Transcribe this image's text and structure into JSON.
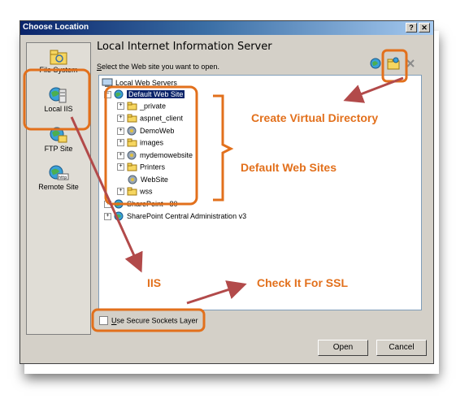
{
  "window": {
    "title": "Choose Location",
    "help_label": "?",
    "close_label": "✕"
  },
  "sidebar": {
    "items": [
      {
        "label": "File System",
        "icon": "folder-icon"
      },
      {
        "label": "Local IIS",
        "icon": "server-icon"
      },
      {
        "label": "FTP Site",
        "icon": "ftp-icon"
      },
      {
        "label": "Remote Site",
        "icon": "globe-icon"
      }
    ]
  },
  "panel": {
    "title": "Local Internet Information Server",
    "subtitle_prefix": "S",
    "subtitle_rest": "elect the Web site you want to open."
  },
  "toolbar": {
    "create_vdir_icon": "new-virtual-directory-icon",
    "create_app_icon": "new-application-icon",
    "delete_icon": "delete-icon"
  },
  "tree": {
    "root": "Local Web Servers",
    "default_site": "Default Web Site",
    "children": [
      "_private",
      "aspnet_client",
      "DemoWeb",
      "images",
      "mydemowebsite",
      "Printers",
      "WebSite",
      "wss"
    ],
    "other_sites": [
      "SharePoint - 80",
      "SharePoint Central Administration v3"
    ],
    "expand_symbol": "+",
    "collapse_symbol": "−"
  },
  "ssl": {
    "label_prefix": "U",
    "label_rest": "se Secure Sockets Layer",
    "checked": false
  },
  "buttons": {
    "open": "Open",
    "cancel": "Cancel"
  },
  "annotations": {
    "create_vdir": "Create Virtual Directory",
    "default_sites": "Default Web Sites",
    "iis": "IIS",
    "ssl": "Check It For SSL",
    "color": "#e2701c"
  }
}
